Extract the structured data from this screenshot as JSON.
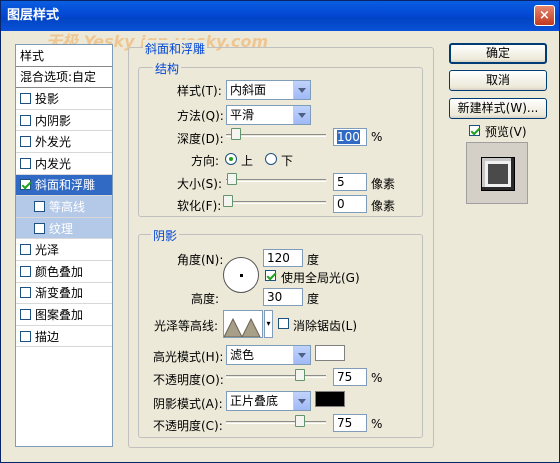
{
  "window": {
    "title": "图层样式",
    "close": "×"
  },
  "watermark": "天极 Yesky ign.yesky.com",
  "left_list": {
    "header": "样式",
    "blend": "混合选项:自定",
    "items": [
      {
        "label": "投影",
        "checked": false
      },
      {
        "label": "内阴影",
        "checked": false
      },
      {
        "label": "外发光",
        "checked": false
      },
      {
        "label": "内发光",
        "checked": false
      },
      {
        "label": "斜面和浮雕",
        "checked": true
      },
      {
        "label": "等高线",
        "checked": false
      },
      {
        "label": "纹理",
        "checked": false
      },
      {
        "label": "光泽",
        "checked": false
      },
      {
        "label": "颜色叠加",
        "checked": false
      },
      {
        "label": "渐变叠加",
        "checked": false
      },
      {
        "label": "图案叠加",
        "checked": false
      },
      {
        "label": "描边",
        "checked": false
      }
    ]
  },
  "bevel": {
    "section_title": "斜面和浮雕",
    "structure_title": "结构",
    "style_label": "样式(T):",
    "style_value": "内斜面",
    "technique_label": "方法(Q):",
    "technique_value": "平滑",
    "depth_label": "深度(D):",
    "depth_value": "100",
    "depth_unit": "%",
    "depth_level": 0.1,
    "direction_label": "方向:",
    "direction_up": "上",
    "direction_down": "下",
    "direction_selected": "上",
    "size_label": "大小(S):",
    "size_value": "5",
    "size_unit": "像素",
    "soften_label": "软化(F):",
    "soften_value": "0",
    "soften_unit": "像素"
  },
  "shading": {
    "title": "阴影",
    "angle_label": "角度(N):",
    "angle_value": "120",
    "angle_unit": "度",
    "global_light_label": "使用全局光(G)",
    "global_light_checked": true,
    "altitude_label": "高度:",
    "altitude_value": "30",
    "altitude_unit": "度",
    "gloss_label": "光泽等高线:",
    "antialias_label": "消除锯齿(L)",
    "antialias_checked": false,
    "highlight_mode_label": "高光模式(H):",
    "highlight_mode_value": "滤色",
    "highlight_color": "#ffffff",
    "highlight_opacity_label": "不透明度(O):",
    "highlight_opacity_value": "75",
    "highlight_opacity_unit": "%",
    "shadow_mode_label": "阴影模式(A):",
    "shadow_mode_value": "正片叠底",
    "shadow_color": "#000000",
    "shadow_opacity_label": "不透明度(C):",
    "shadow_opacity_value": "75",
    "shadow_opacity_unit": "%"
  },
  "buttons": {
    "ok": "确定",
    "cancel": "取消",
    "new_style": "新建样式(W)...",
    "preview": "预览(V)",
    "preview_checked": true
  }
}
